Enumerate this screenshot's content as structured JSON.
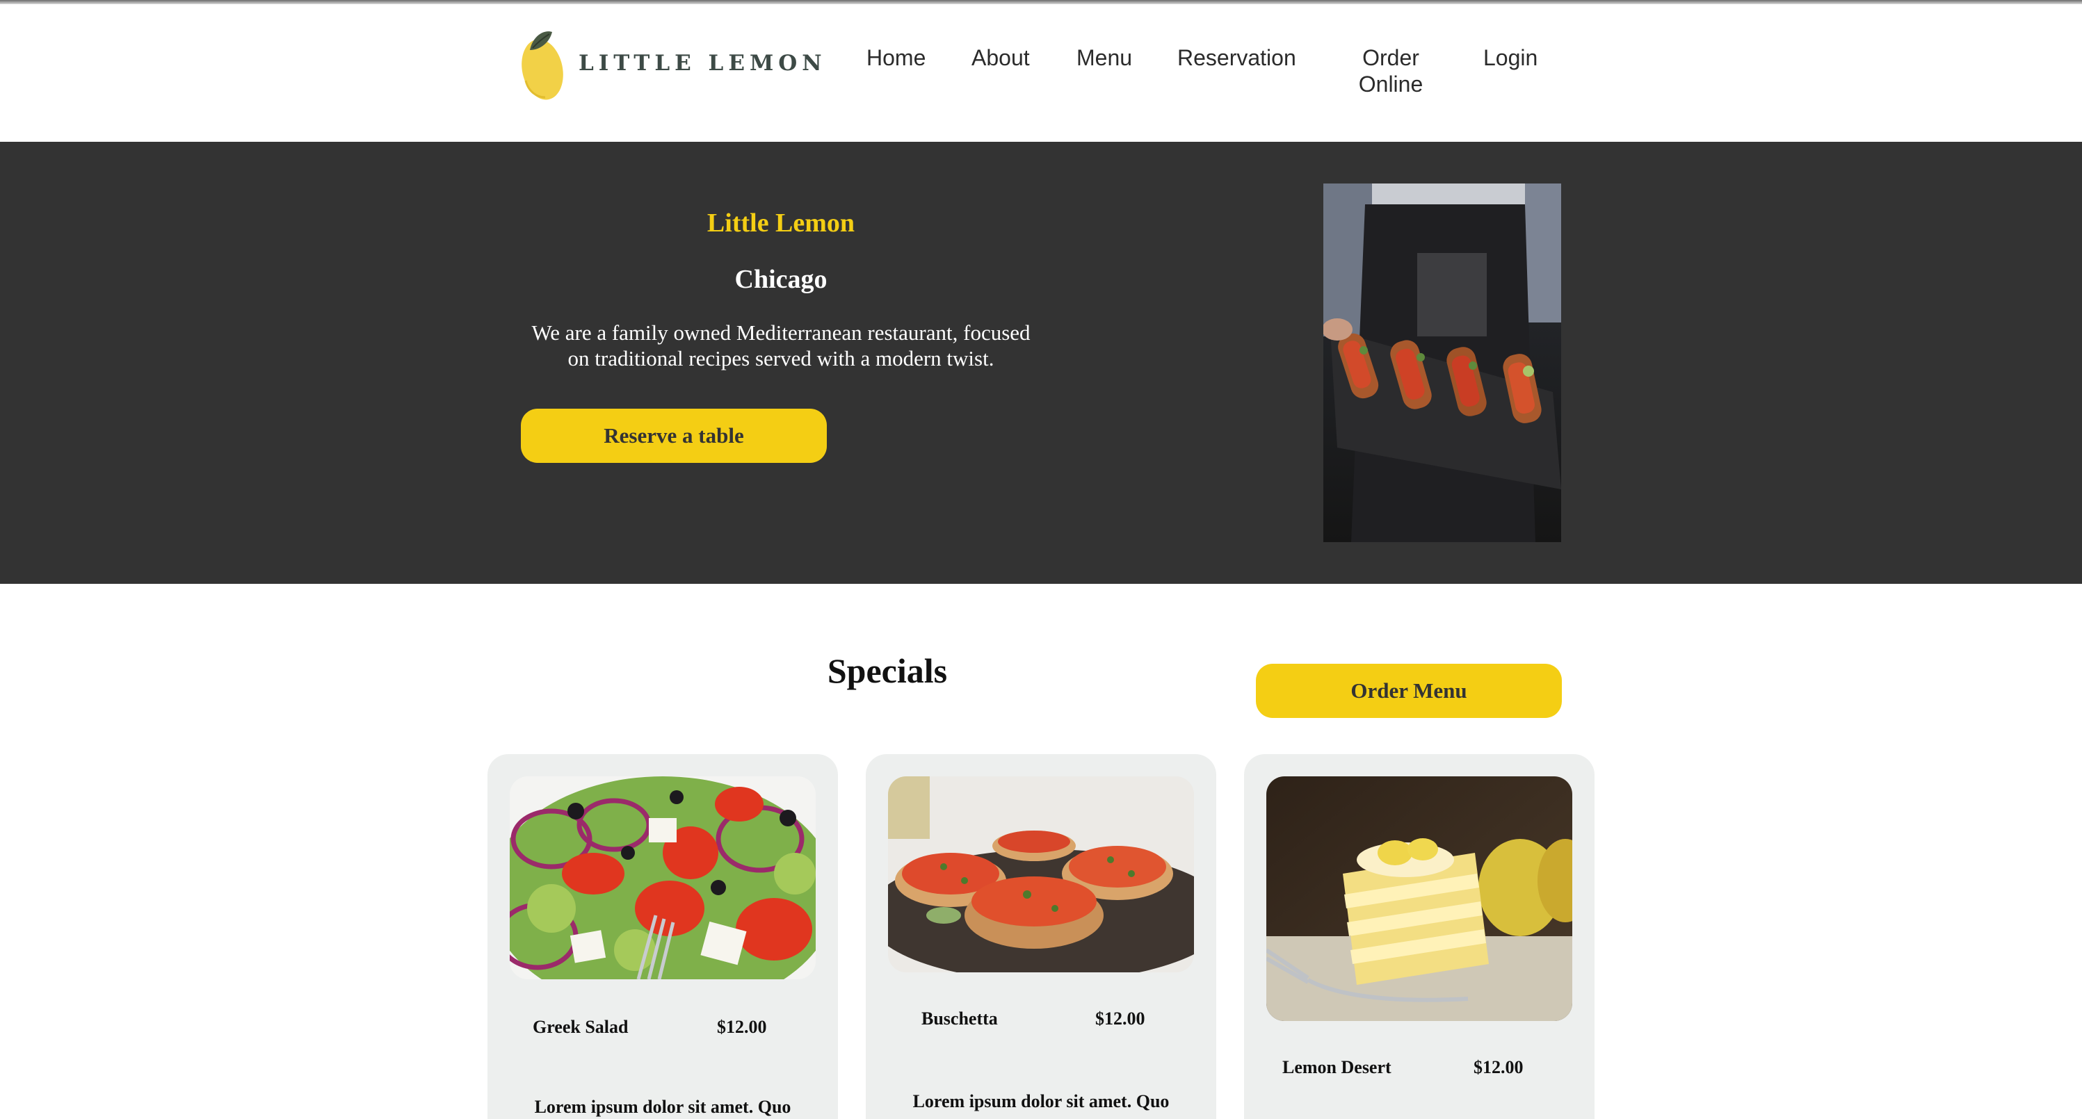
{
  "colors": {
    "primary_yellow": "#f4ce14",
    "hero_background": "#333333",
    "card_background": "#edefee",
    "logo_text": "#3d4a46"
  },
  "header": {
    "logo": {
      "icon": "lemon-icon",
      "text": "LITTLE LEMON"
    },
    "nav": [
      {
        "label": "Home"
      },
      {
        "label": "About"
      },
      {
        "label": "Menu"
      },
      {
        "label": "Reservation"
      },
      {
        "label": "Order Online"
      },
      {
        "label": "Login"
      }
    ]
  },
  "hero": {
    "title": "Little Lemon",
    "city": "Chicago",
    "description": "We are a family owned Mediterranean restaurant, focused on traditional recipes served with a modern twist.",
    "cta_label": "Reserve a table",
    "image": "chef-holding-bruschetta-platter"
  },
  "specials": {
    "title": "Specials",
    "order_button_label": "Order Menu",
    "items": [
      {
        "name": "Greek Salad",
        "price": "$12.00",
        "description": "Lorem ipsum dolor sit amet. Quo",
        "image": "greek-salad-photo"
      },
      {
        "name": "Buschetta",
        "price": "$12.00",
        "description": "Lorem ipsum dolor sit amet. Quo",
        "image": "bruschetta-photo"
      },
      {
        "name": "Lemon Desert",
        "price": "$12.00",
        "description": "",
        "image": "lemon-cake-photo"
      }
    ]
  }
}
